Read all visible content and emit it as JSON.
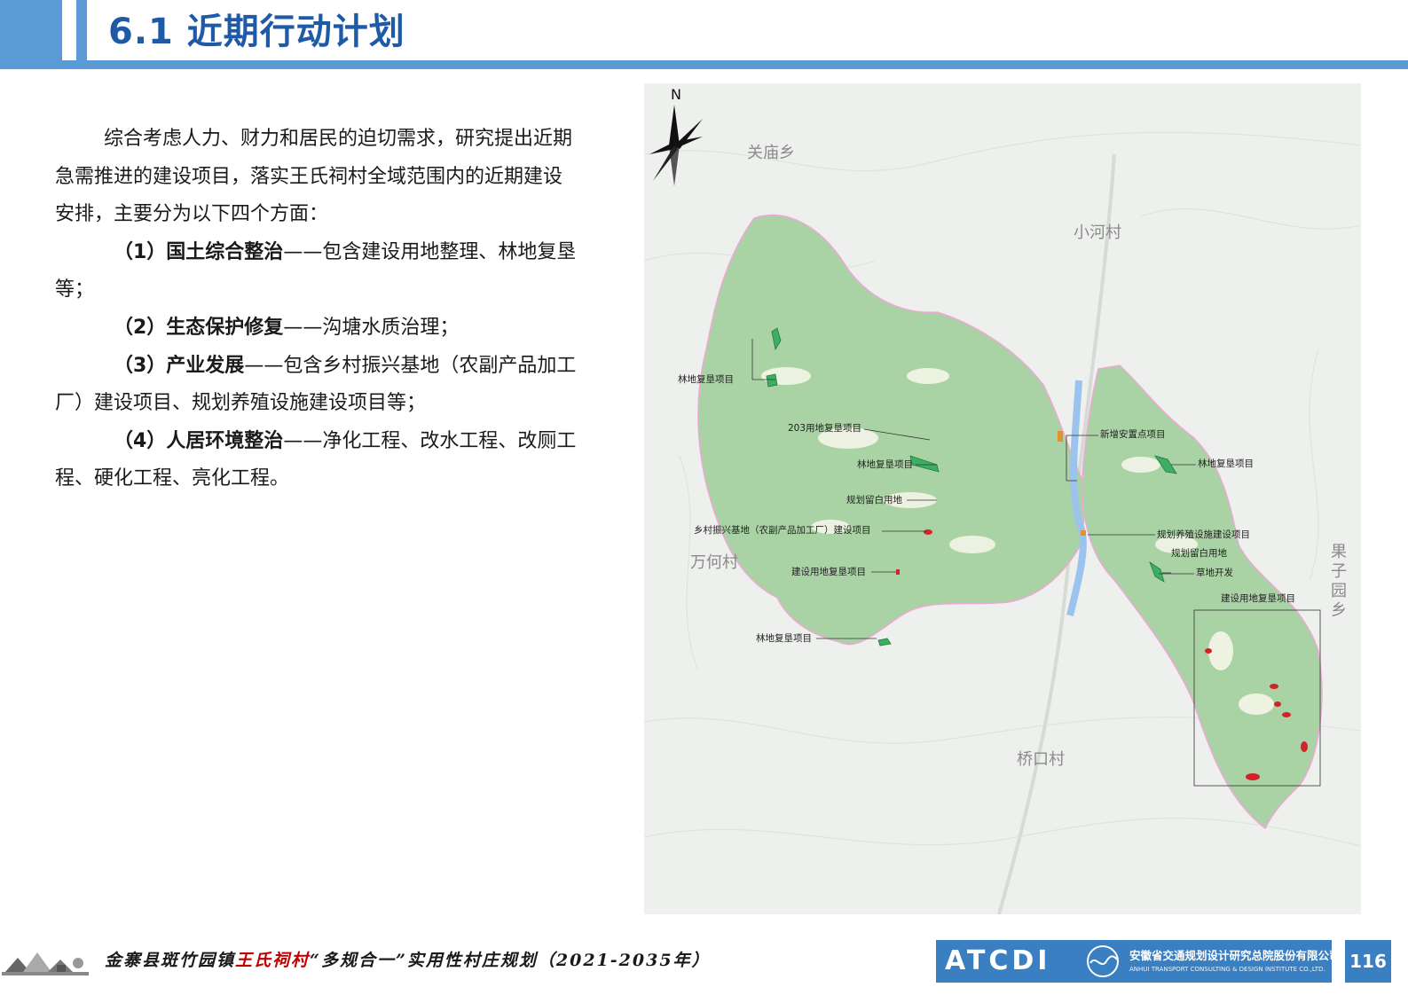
{
  "header": {
    "title": "6.1 近期行动计划"
  },
  "intro": "综合考虑人力、财力和居民的迫切需求，研究提出近期急需推进的建设项目，落实王氏祠村全域范围内的近期建设安排，主要分为以下四个方面：",
  "items": [
    {
      "title": "（1）国土综合整治",
      "desc": "——包含建设用地整理、林地复垦等；"
    },
    {
      "title": "（2）生态保护修复",
      "desc": "——沟塘水质治理；"
    },
    {
      "title": "（3）产业发展",
      "desc": "——包含乡村振兴基地（农副产品加工厂）建设项目、规划养殖设施建设项目等；"
    },
    {
      "title": "（4）人居环境整治",
      "desc": "——净化工程、改水工程、改厕工程、硬化工程、亮化工程。"
    }
  ],
  "map": {
    "north_label": "N",
    "places": {
      "guanmiao": "关庙乡",
      "xiaohe": "小河村",
      "wanhe": "万何村",
      "qiaokou": "桥口村",
      "guoziyuan": "果子园乡"
    },
    "labels": {
      "forest1": "林地复垦项目",
      "land203": "203用地复垦项目",
      "forest2": "林地复垦项目",
      "reserve1": "规划留白用地",
      "rural_base": "乡村振兴基地（农副产品加工厂）建设项目",
      "construct1": "建设用地复垦项目",
      "forest3": "林地复垦项目",
      "resettle": "新增安置点项目",
      "forest4": "林地复垦项目",
      "breeding": "规划养殖设施建设项目",
      "reserve2": "规划留白用地",
      "grassland": "草地开发",
      "construct2": "建设用地复垦项目"
    },
    "colors": {
      "village_area": "#a9d3a4",
      "forest_project": "#3fae63",
      "construction_project": "#d2232a",
      "water": "#9cc3ee"
    }
  },
  "footer": {
    "title_prefix": "金寨县斑竹园镇",
    "title_village": "王氏祠村",
    "title_suffix": "“多规合一”实用性村庄规划（2021-2035年）",
    "logo": "ATCDI",
    "company_cn": "安徽省交通规划设计研究总院股份有限公司",
    "company_en": "ANHUI TRANSPORT CONSULTING & DESIGN INSTITUTE CO.,LTD.",
    "page_number": "116"
  }
}
